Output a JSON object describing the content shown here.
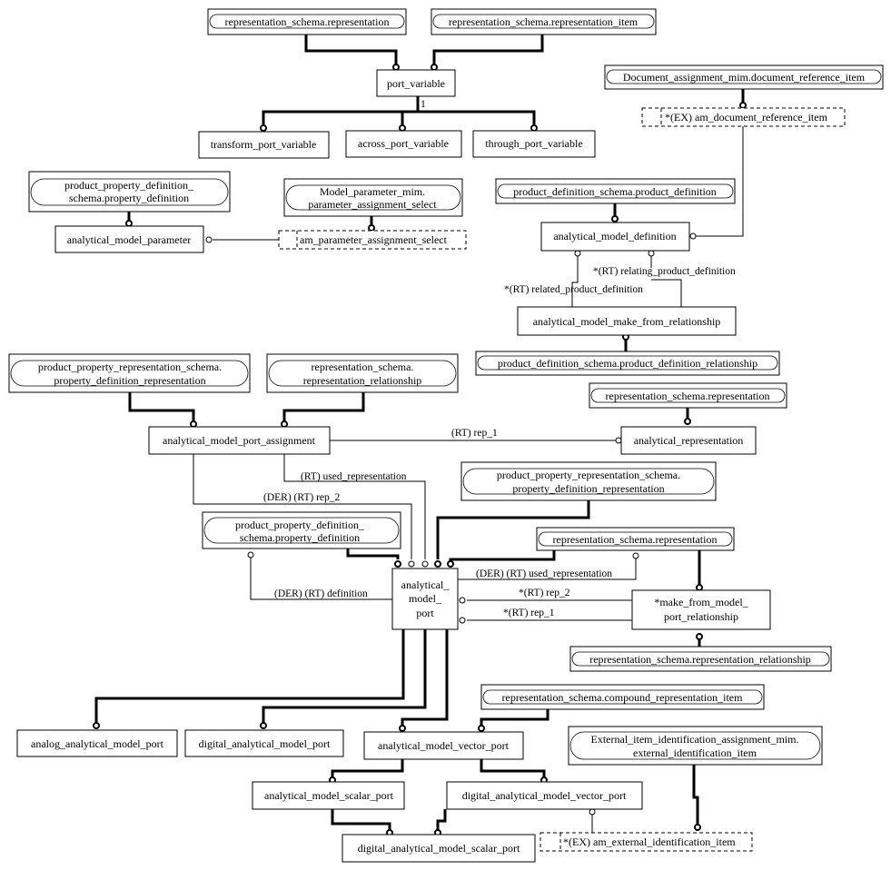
{
  "diagram": {
    "entities": {
      "rep_schema_representation_top": "representation_schema.representation",
      "rep_schema_representation_item": "representation_schema.representation_item",
      "port_variable": "port_variable",
      "transform_port_variable": "transform_port_variable",
      "across_port_variable": "across_port_variable",
      "through_port_variable": "through_port_variable",
      "document_reference_item": "Document_assignment_mim.document_reference_item",
      "am_document_reference_item": "*(EX) am_document_reference_item",
      "ppd_property_definition_top": [
        "product_property_definition_",
        "schema.property_definition"
      ],
      "analytical_model_parameter": "analytical_model_parameter",
      "model_parameter_select": [
        "Model_parameter_mim.",
        "parameter_assignment_select"
      ],
      "am_parameter_assignment_select": "am_parameter_assignment_select",
      "pd_product_definition": "product_definition_schema.product_definition",
      "analytical_model_definition": "analytical_model_definition",
      "analytical_model_make_from_relationship": "analytical_model_make_from_relationship",
      "pd_product_definition_relationship": "product_definition_schema.product_definition_relationship",
      "ppr_property_definition_representation_left": [
        "product_property_representation_schema.",
        "property_definition_representation"
      ],
      "rep_schema_representation_relationship_top": [
        "representation_schema.",
        "representation_relationship"
      ],
      "rep_schema_representation_mid": "representation_schema.representation",
      "analytical_model_port_assignment": "analytical_model_port_assignment",
      "analytical_representation": "analytical_representation",
      "ppr_property_definition_representation_mid": [
        "product_property_representation_schema.",
        "property_definition_representation"
      ],
      "ppd_property_definition_mid": [
        "product_property_definition_",
        "schema.property_definition"
      ],
      "rep_schema_representation_low": "representation_schema.representation",
      "analytical_model_port": [
        "analytical_",
        "model_",
        "port"
      ],
      "make_from_model_port_relationship": [
        "*make_from_model_",
        "port_relationship"
      ],
      "rep_schema_representation_relationship_low": "representation_schema.representation_relationship",
      "compound_representation_item": "representation_schema.compound_representation_item",
      "external_identification_item": [
        "External_item_identification_assignment_mim.",
        "external_identification_item"
      ],
      "analog_analytical_model_port": "analog_analytical_model_port",
      "digital_analytical_model_port": "digital_analytical_model_port",
      "analytical_model_vector_port": "analytical_model_vector_port",
      "analytical_model_scalar_port": "analytical_model_scalar_port",
      "digital_analytical_model_vector_port": "digital_analytical_model_vector_port",
      "digital_analytical_model_scalar_port": "digital_analytical_model_scalar_port",
      "am_external_identification_item": "*(EX) am_external_identification_item"
    },
    "labels": {
      "one": "1",
      "relating_product_definition": "*(RT) relating_product_definition",
      "related_product_definition": "*(RT) related_product_definition",
      "rep_1_top": "(RT) rep_1",
      "used_representation": "(RT) used_representation",
      "der_rep_2": "(DER) (RT) rep_2",
      "der_used_representation": "(DER) (RT) used_representation",
      "rep_2_star": "*(RT) rep_2",
      "rep_1_star": "*(RT) rep_1",
      "der_definition": "(DER) (RT) definition"
    }
  }
}
